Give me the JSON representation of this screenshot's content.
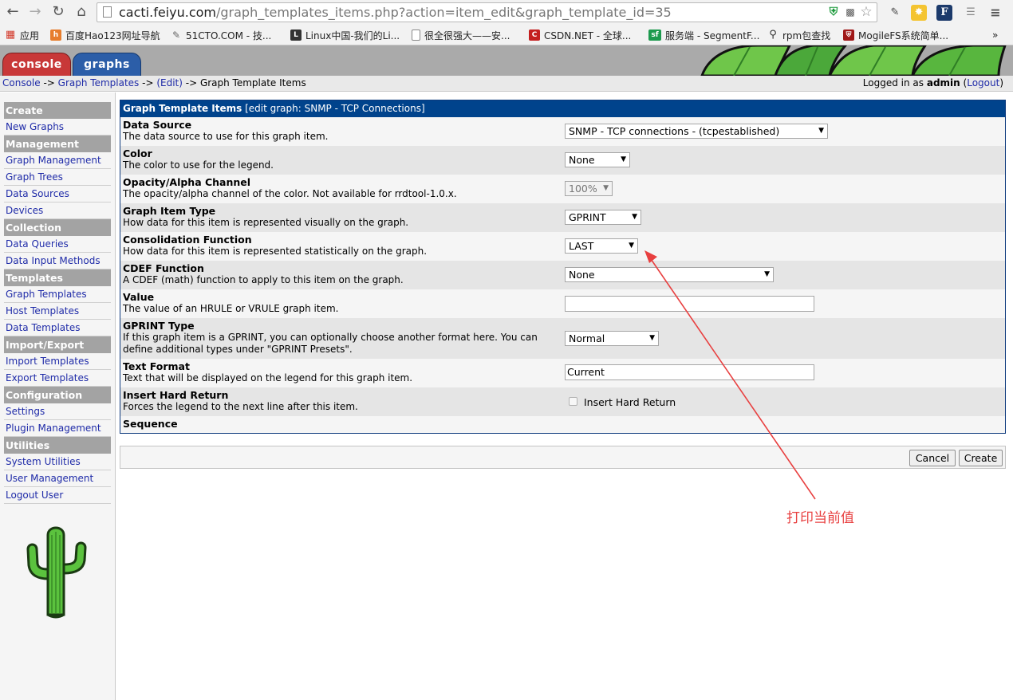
{
  "browser": {
    "url_host": "cacti.feiyu.com",
    "url_rest": "/graph_templates_items.php?action=item_edit&graph_template_id=35",
    "bookmarks": [
      {
        "label": "应用",
        "color": "#d33b2c"
      },
      {
        "label": "百度Hao123网址导航",
        "color": "#e77d2c"
      },
      {
        "label": "51CTO.COM - 技...",
        "color": "#666666"
      },
      {
        "label": "Linux中国-我们的Li...",
        "color": "#333333"
      },
      {
        "label": "很全很强大——安...",
        "color": "#999999"
      },
      {
        "label": "CSDN.NET - 全球...",
        "color": "#c41f1f"
      },
      {
        "label": "服务端 - SegmentF...",
        "color": "#1d9a4e"
      },
      {
        "label": "rpm包查找",
        "color": "#444444"
      },
      {
        "label": "MogileFS系统简单...",
        "color": "#a01818"
      }
    ],
    "bookmarks_overflow": "»"
  },
  "header": {
    "tabs": {
      "console": "console",
      "graphs": "graphs"
    }
  },
  "breadcrumb": {
    "console": "Console",
    "sep1": " -> ",
    "graph_templates": "Graph Templates",
    "sep2": " -> ",
    "edit": "(Edit)",
    "sep3": " -> ",
    "current": "Graph Template Items"
  },
  "login": {
    "prefix": "Logged in as ",
    "user": "admin",
    "logout": "Logout"
  },
  "sidebar": {
    "sections": [
      {
        "head": "Create",
        "items": [
          "New Graphs"
        ]
      },
      {
        "head": "Management",
        "items": [
          "Graph Management",
          "Graph Trees",
          "Data Sources",
          "Devices"
        ]
      },
      {
        "head": "Collection Methods",
        "items": [
          "Data Queries",
          "Data Input Methods"
        ]
      },
      {
        "head": "Templates",
        "items": [
          "Graph Templates",
          "Host Templates",
          "Data Templates"
        ]
      },
      {
        "head": "Import/Export",
        "items": [
          "Import Templates",
          "Export Templates"
        ]
      },
      {
        "head": "Configuration",
        "items": [
          "Settings",
          "Plugin Management"
        ]
      },
      {
        "head": "Utilities",
        "items": [
          "System Utilities",
          "User Management",
          "Logout User"
        ]
      }
    ]
  },
  "form": {
    "title": "Graph Template Items",
    "subtitle": "[edit graph: SNMP - TCP Connections]",
    "fields": {
      "data_source": {
        "label": "Data Source",
        "desc": "The data source to use for this graph item.",
        "value": "SNMP - TCP connections - (tcpestablished)"
      },
      "color": {
        "label": "Color",
        "desc": "The color to use for the legend.",
        "value": "None"
      },
      "opacity": {
        "label": "Opacity/Alpha Channel",
        "desc": "The opacity/alpha channel of the color. Not available for rrdtool-1.0.x.",
        "value": "100%"
      },
      "item_type": {
        "label": "Graph Item Type",
        "desc": "How data for this item is represented visually on the graph.",
        "value": "GPRINT"
      },
      "consolidation": {
        "label": "Consolidation Function",
        "desc": "How data for this item is represented statistically on the graph.",
        "value": "LAST"
      },
      "cdef": {
        "label": "CDEF Function",
        "desc": "A CDEF (math) function to apply to this item on the graph.",
        "value": "None"
      },
      "value": {
        "label": "Value",
        "desc": "The value of an HRULE or VRULE graph item.",
        "value": ""
      },
      "gprint_type": {
        "label": "GPRINT Type",
        "desc": "If this graph item is a GPRINT, you can optionally choose another format here. You can define additional types under \"GPRINT Presets\".",
        "value": "Normal"
      },
      "text_format": {
        "label": "Text Format",
        "desc": "Text that will be displayed on the legend for this graph item.",
        "value": "Current"
      },
      "hard_return": {
        "label": "Insert Hard Return",
        "desc": "Forces the legend to the next line after this item.",
        "checkbox_label": "Insert Hard Return",
        "checked": false
      },
      "sequence": {
        "label": "Sequence"
      }
    }
  },
  "actions": {
    "cancel": "Cancel",
    "create": "Create"
  },
  "annotation": {
    "text": "打印当前值",
    "color": "#e84040"
  }
}
